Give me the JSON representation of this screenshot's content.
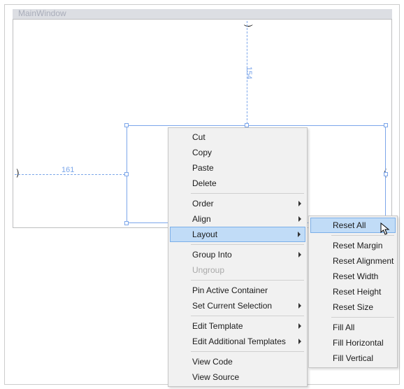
{
  "window": {
    "title": "MainWindow"
  },
  "guides": {
    "v_label": "154",
    "h_label": "161"
  },
  "context_menu": {
    "cut": "Cut",
    "copy": "Copy",
    "paste": "Paste",
    "delete": "Delete",
    "order": "Order",
    "align": "Align",
    "layout": "Layout",
    "group_into": "Group Into",
    "ungroup": "Ungroup",
    "pin_active_container": "Pin Active Container",
    "set_current_selection": "Set Current Selection",
    "edit_template": "Edit Template",
    "edit_additional_templates": "Edit Additional Templates",
    "view_code": "View Code",
    "view_source": "View Source"
  },
  "layout_submenu": {
    "reset_all": "Reset All",
    "reset_margin": "Reset Margin",
    "reset_alignment": "Reset Alignment",
    "reset_width": "Reset Width",
    "reset_height": "Reset Height",
    "reset_size": "Reset Size",
    "fill_all": "Fill All",
    "fill_horizontal": "Fill Horizontal",
    "fill_vertical": "Fill Vertical"
  }
}
